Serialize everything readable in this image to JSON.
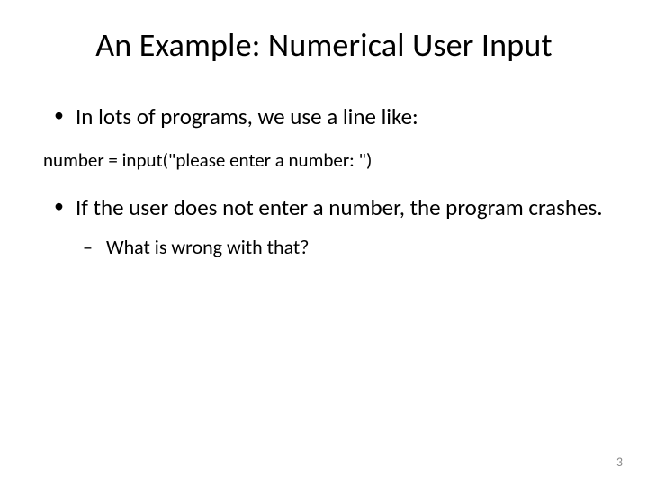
{
  "title": "An Example: Numerical User Input",
  "bullets": {
    "b1": "In lots of programs, we use a line like:",
    "code": "number = input(\"please enter a number: \")",
    "b2": "If the user does not enter a number, the program crashes.",
    "b2_sub1": "What is wrong with that?"
  },
  "page_number": "3"
}
